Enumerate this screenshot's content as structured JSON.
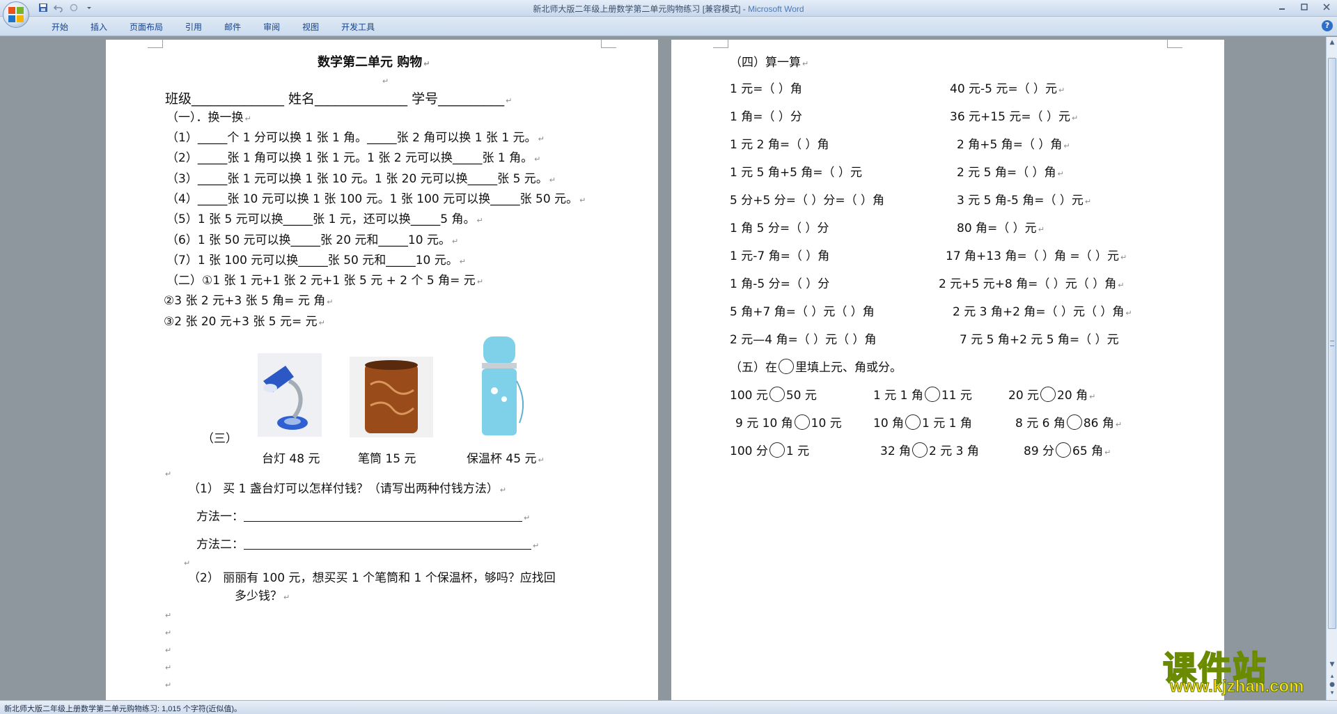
{
  "window": {
    "title": "新北师大版二年级上册数学第二单元购物练习 [兼容模式]",
    "app_name": "Microsoft Word"
  },
  "ribbon_tabs": [
    "开始",
    "插入",
    "页面布局",
    "引用",
    "邮件",
    "审阅",
    "视图",
    "开发工具"
  ],
  "status": {
    "text": "新北师大版二年级上册数学第二单元购物练习: 1,015 个字符(近似值)。"
  },
  "watermark": {
    "main": "课件站",
    "url": "www.kjzhan.com"
  },
  "left_page": {
    "title": "数学第二单元     购物",
    "info_line": "班级______________     姓名______________     学号__________",
    "section1_heading": "（一）．换一换",
    "section1_items": [
      "（1）_____个 1 分可以换 1 张 1 角。_____张 2 角可以换 1 张 1 元。",
      "（2）_____张 1 角可以换 1 张 1 元。1 张 2 元可以换_____张 1 角。",
      "（3）_____张 1 元可以换 1 张 10 元。1 张 20 元可以换_____张 5 元。",
      "（4）_____张 10 元可以换 1 张 100 元。1 张 100 元可以换_____张 50 元。",
      "（5）1 张 5 元可以换_____张 1 元，还可以换_____5 角。",
      "（6）1 张 50 元可以换_____张 20 元和_____10 元。",
      "（7）1 张 100 元可以换_____张 50 元和_____10 元。"
    ],
    "section2_items": [
      "（二）①1 张 1 元+1 张 2 元+1 张 5 元 + 2 个 5 角=          元",
      "②3 张 2 元+3 张 5 角=        元          角",
      "③2 张 20 元+3 张 5 元=        元"
    ],
    "section3_label": "（三）",
    "products": [
      {
        "name": "台灯 48 元",
        "icon": "desk-lamp"
      },
      {
        "name": "笔筒 15 元",
        "icon": "pen-holder"
      },
      {
        "name": "保温杯 45 元",
        "icon": "thermos-bottle"
      }
    ],
    "q1": "（1）    买 1 盏台灯可以怎样付钱？（请写出两种付钱方法）",
    "method1_label": "方法一：",
    "method2_label": "方法二：",
    "q2_line1": "（2）    丽丽有 100 元，想买买 1 个笔筒和 1 个保温杯，够吗？应找回",
    "q2_line2": "多少钱？"
  },
  "right_page": {
    "section4_heading": "（四）算一算",
    "calc_left": [
      "1 元=（    ）角",
      "1 角=（    ）分",
      "1 元 2 角=（    ）角",
      "1 元 5 角+5 角=（    ）元",
      "5 分+5 分=（    ）分=（    ）角",
      "1 角 5 分=（    ）分",
      "1 元-7 角=（    ）角",
      "1 角-5 分=（    ）分",
      "5 角+7 角=（    ）元（    ）角",
      "2 元—4 角=（    ）元（    ）角"
    ],
    "calc_right": [
      "40 元-5 元=（    ）元",
      "36 元+15 元=（    ）元",
      "2 角+5 角=（    ）角",
      "2 元 5 角=（    ）角",
      "3 元 5 角-5 角=（    ）元",
      "80 角=（    ）元",
      "17 角+13 角=（    ）角 =（    ）元",
      "2 元+5 元+8 角=（    ）元（    ）角",
      "2 元 3 角+2 角=（    ）元（    ）角",
      "7 元 5 角+2 元 5 角=（    ）元"
    ],
    "section5_pre": "（五）在",
    "section5_post": "里填上元、角或分。",
    "compare": [
      [
        "100 元",
        "50 元"
      ],
      [
        "1 元 1 角",
        "11 元"
      ],
      [
        "20 元",
        "20 角"
      ],
      [
        "9 元 10 角",
        "10 元"
      ],
      [
        "10 角",
        "1 元 1 角"
      ],
      [
        "8 元 6 角",
        "86 角"
      ],
      [
        "100 分",
        "1 元"
      ],
      [
        "32 角",
        "2 元 3 角"
      ],
      [
        "89 分",
        "65 角"
      ]
    ]
  }
}
